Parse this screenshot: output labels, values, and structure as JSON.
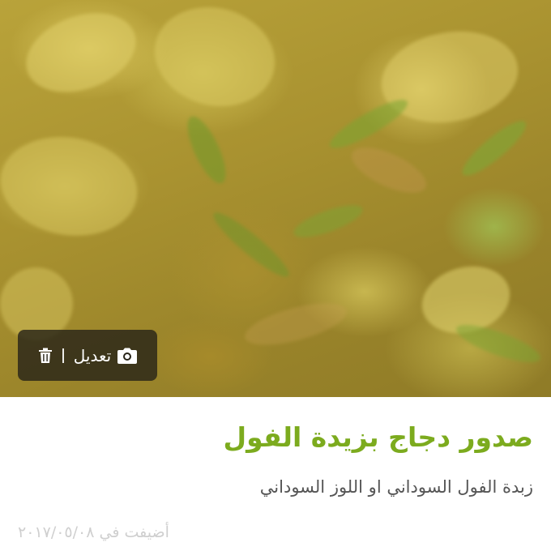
{
  "recipe": {
    "title": "صدور دجاج بزيدة الفول",
    "subtitle": "زبدة الفول السوداني او اللوز السوداني",
    "added_date": "أضيفت في ٢٠١٧/٠٥/٠٨"
  },
  "photo_overlay": {
    "edit_label": "تعديل",
    "camera_icon": "camera-icon",
    "trash_icon": "trash-icon",
    "background_color": "#282418"
  },
  "colors": {
    "title": "#7cab1e",
    "subtitle": "#555555",
    "date": "#cfcfcf"
  }
}
